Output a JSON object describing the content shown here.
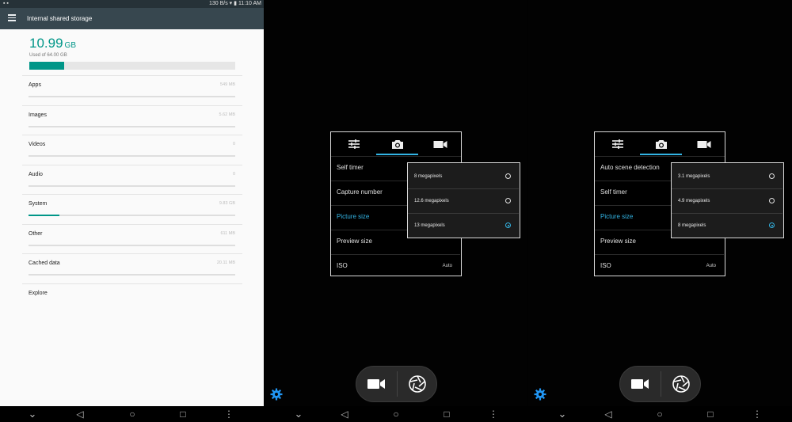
{
  "storage_screen": {
    "status_bar": {
      "speed": "130 B/s",
      "time": "11:10 AM"
    },
    "app_bar": {
      "title": "Internal shared storage",
      "menu_icon": "hamburger-menu-icon"
    },
    "summary": {
      "used_value": "10.99",
      "used_unit": "GB",
      "used_of": "Used of 64.00 GB",
      "used_fraction": 0.17,
      "accent_color": "#009688"
    },
    "categories": [
      {
        "label": "Apps",
        "size": "549 MB",
        "fraction": 0.0
      },
      {
        "label": "Images",
        "size": "5.62 MB",
        "fraction": 0.0
      },
      {
        "label": "Videos",
        "size": "0",
        "fraction": 0.0
      },
      {
        "label": "Audio",
        "size": "0",
        "fraction": 0.0
      },
      {
        "label": "System",
        "size": "9.83 GB",
        "fraction": 0.15
      },
      {
        "label": "Other",
        "size": "611 MB",
        "fraction": 0.0
      },
      {
        "label": "Cached data",
        "size": "20.11 MB",
        "fraction": 0.0
      },
      {
        "label": "Explore"
      }
    ]
  },
  "camera_screen_1": {
    "tabs": [
      {
        "icon": "sliders-icon",
        "active": false
      },
      {
        "icon": "camera-icon",
        "active": true
      },
      {
        "icon": "video-camera-icon",
        "active": false
      }
    ],
    "rows": [
      {
        "label": "Self timer",
        "value": "",
        "highlighted": false
      },
      {
        "label": "Capture number",
        "value": "",
        "highlighted": false
      },
      {
        "label": "Picture size",
        "value": "",
        "highlighted": true
      },
      {
        "label": "Preview size",
        "value": "",
        "highlighted": false
      },
      {
        "label": "ISO",
        "value": "Auto",
        "highlighted": false
      }
    ],
    "popup_options": [
      {
        "label": "8 megapixels",
        "selected": false
      },
      {
        "label": "12.6 megapixels",
        "selected": false
      },
      {
        "label": "13 megapixels",
        "selected": true
      }
    ]
  },
  "camera_screen_2": {
    "tabs": [
      {
        "icon": "sliders-icon",
        "active": false
      },
      {
        "icon": "camera-icon",
        "active": true
      },
      {
        "icon": "video-camera-icon",
        "active": false
      }
    ],
    "rows": [
      {
        "label": "Auto scene detection",
        "value": "",
        "highlighted": false
      },
      {
        "label": "Self timer",
        "value": "",
        "highlighted": false
      },
      {
        "label": "Picture size",
        "value": "",
        "highlighted": true
      },
      {
        "label": "Preview size",
        "value": "",
        "highlighted": false
      },
      {
        "label": "ISO",
        "value": "Auto",
        "highlighted": false
      }
    ],
    "popup_options": [
      {
        "label": "3.1 megapixels",
        "selected": false
      },
      {
        "label": "4.9 megapixels",
        "selected": false
      },
      {
        "label": "8 megapixels",
        "selected": true
      }
    ]
  },
  "nav_bar": {
    "down": "⌄",
    "back": "◁",
    "home": "○",
    "recents": "□",
    "more": "⋮"
  },
  "theme": {
    "highlight_color": "#33b5e5",
    "storage_appbar_color": "#37474f"
  }
}
